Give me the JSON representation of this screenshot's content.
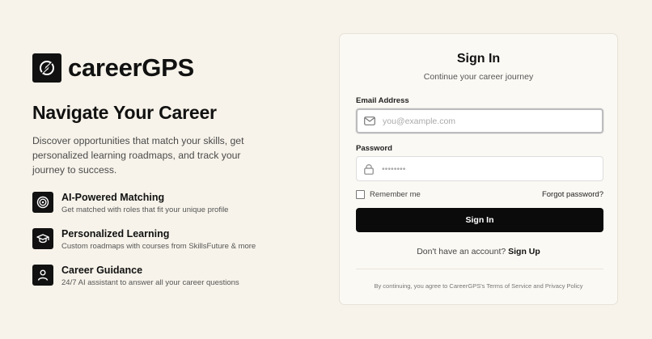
{
  "brand": {
    "name": "careerGPS",
    "logo_icon": "compass-icon"
  },
  "hero": {
    "headline": "Navigate Your Career",
    "description": "Discover opportunities that match your skills, get personalized learning roadmaps, and track your journey to success."
  },
  "features": [
    {
      "icon": "target-icon",
      "title": "AI-Powered Matching",
      "subtitle": "Get matched with roles that fit your unique profile"
    },
    {
      "icon": "graduation-cap-icon",
      "title": "Personalized Learning",
      "subtitle": "Custom roadmaps with courses from SkillsFuture & more"
    },
    {
      "icon": "user-icon",
      "title": "Career Guidance",
      "subtitle": "24/7 AI assistant to answer all your career questions"
    }
  ],
  "signin": {
    "title": "Sign In",
    "subtitle": "Continue your career journey",
    "email_label": "Email Address",
    "email_placeholder": "you@example.com",
    "email_value": "",
    "password_label": "Password",
    "password_placeholder": "••••••••",
    "remember_label": "Remember me",
    "remember_checked": false,
    "forgot_label": "Forgot password?",
    "button_label": "Sign In",
    "no_account_text": "Don't have an account?",
    "signup_label": "Sign Up",
    "legal_text": "By continuing, you agree to CareerGPS's Terms of Service and Privacy Policy"
  },
  "colors": {
    "background": "#f7f3ea",
    "primary": "#0b0b0b",
    "card": "#fbf9f4"
  }
}
